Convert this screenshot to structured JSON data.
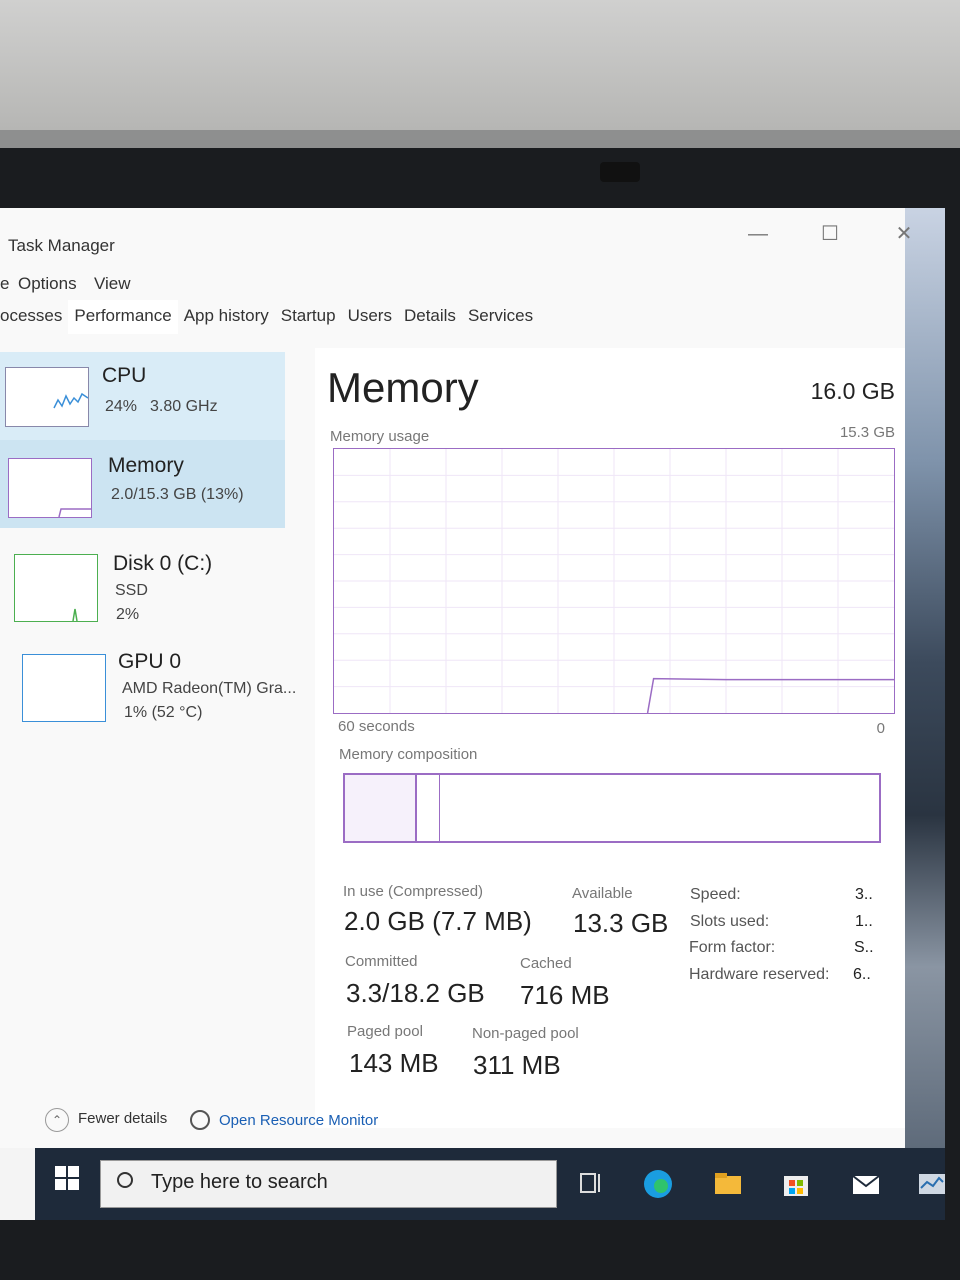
{
  "window": {
    "title": "Task Manager",
    "minimize": "—",
    "maximize": "☐",
    "close": "✕"
  },
  "menu": {
    "options": "Options",
    "view": "View",
    "file_partial": "e"
  },
  "tabs": [
    "ocesses",
    "Performance",
    "App history",
    "Startup",
    "Users",
    "Details",
    "Services"
  ],
  "sidebar": [
    {
      "name": "CPU",
      "line1": "24%",
      "line1b": "3.80 GHz"
    },
    {
      "name": "Memory",
      "line1": "2.0/15.3 GB (13%)"
    },
    {
      "name": "Disk 0 (C:)",
      "line1": "SSD",
      "line2": "2%"
    },
    {
      "name": "GPU 0",
      "line1": "AMD Radeon(TM) Gra...",
      "line2": "1% (52 °C)"
    }
  ],
  "main": {
    "title": "Memory",
    "total": "16.0 GB",
    "usage_label": "Memory usage",
    "usage_max": "15.3 GB",
    "time_label": "60 seconds",
    "zero": "0",
    "composition_label": "Memory composition",
    "memory_usage_fraction": 0.13
  },
  "stats": {
    "in_use_label": "In use (Compressed)",
    "in_use": "2.0 GB (7.7 MB)",
    "available_label": "Available",
    "available": "13.3 GB",
    "committed_label": "Committed",
    "committed": "3.3/18.2 GB",
    "cached_label": "Cached",
    "cached": "716 MB",
    "paged_label": "Paged pool",
    "paged": "143 MB",
    "nonpaged_label": "Non-paged pool",
    "nonpaged": "311 MB"
  },
  "right_stats": [
    {
      "label": "Speed:",
      "value": "3.."
    },
    {
      "label": "Slots used:",
      "value": "1.."
    },
    {
      "label": "Form factor:",
      "value": "S.."
    },
    {
      "label": "Hardware reserved:",
      "value": "6.."
    }
  ],
  "footer": {
    "fewer": "Fewer details",
    "monitor": "Open Resource Monitor"
  },
  "taskbar": {
    "search_placeholder": "Type here to search"
  },
  "colors": {
    "accent": "#9b6cc4",
    "selected": "#cce4f2",
    "taskbar": "#1e2a3a"
  }
}
